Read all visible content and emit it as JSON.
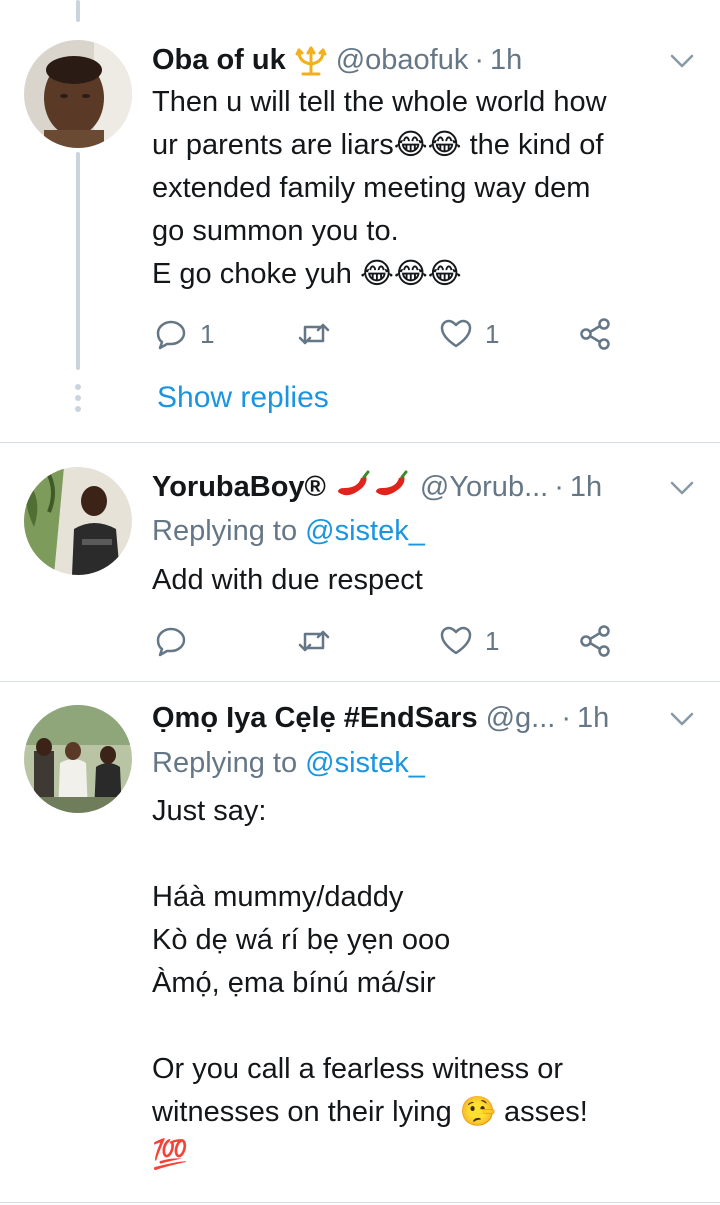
{
  "tweets": [
    {
      "name": "Oba of uk",
      "handle": "@obaofuk",
      "separator": "·",
      "time": "1h",
      "body": "Then u will tell the whole world how\nur parents are liars😂😂 the kind of\nextended family meeting way dem\ngo summon you to.\nE go choke yuh 😂😂😂",
      "reply_count": "1",
      "retweet_count": "",
      "like_count": "1",
      "show_replies": "Show replies"
    },
    {
      "name": "YorubaBoy®",
      "name_emoji": "🌶🌶",
      "handle": "@Yorub...",
      "separator": "·",
      "time": "1h",
      "replying_prefix": "Replying to ",
      "replying_to": "@sistek_",
      "body": "Add with due respect",
      "reply_count": "",
      "retweet_count": "",
      "like_count": "1"
    },
    {
      "name": "Ọmọ Iya Cẹlẹ #EndSars",
      "handle": "@g...",
      "separator": "·",
      "time": "1h",
      "replying_prefix": "Replying to ",
      "replying_to": "@sistek_",
      "body": "Just say:\n\nHáà mummy/daddy\nKò dẹ wá rí bẹ yẹn ooo\nÀmọ́, ẹma bínú má/sir\n\nOr you call a fearless witness or\nwitnesses on their lying 🤥 asses!\n💯",
      "reply_count": "",
      "retweet_count": "",
      "like_count": ""
    }
  ],
  "colors": {
    "accent": "#1b95e0",
    "secondary_text": "#657786",
    "divider": "#d7dde2",
    "thread_line": "#c9d4dc"
  },
  "icons": [
    "trident-icon",
    "chili-pepper-icon",
    "reply-icon",
    "retweet-icon",
    "like-icon",
    "share-icon",
    "chevron-down-icon"
  ]
}
